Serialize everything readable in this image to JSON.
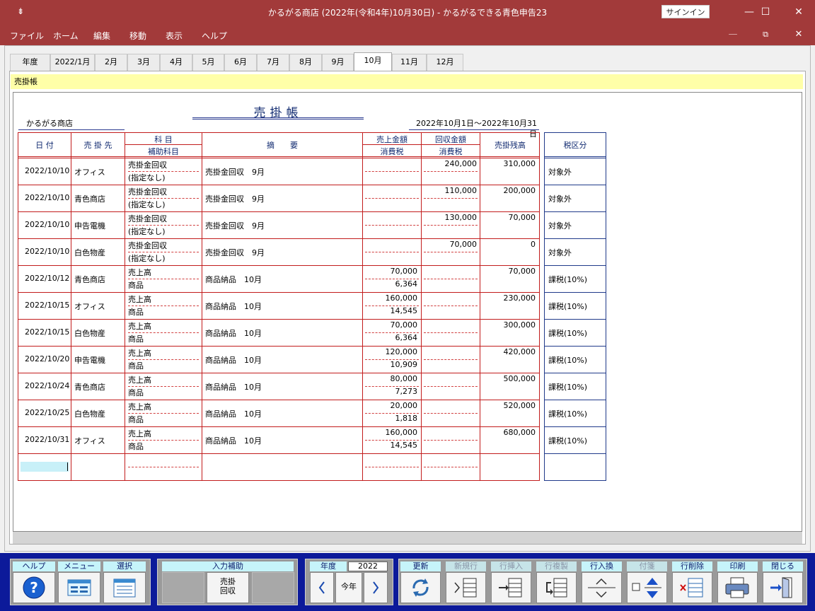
{
  "window": {
    "title": "かるがる商店 (2022年(令和4年)10月30日)  -  かるがるできる青色申告23",
    "signin": "サインイン",
    "sys_menu_glyph": "⇟"
  },
  "menu": [
    "ファイル",
    "ホーム",
    "編集",
    "移動",
    "表示",
    "ヘルプ"
  ],
  "tabs": [
    "年度",
    "2022/1月",
    "2月",
    "3月",
    "4月",
    "5月",
    "6月",
    "7月",
    "8月",
    "9月",
    "10月",
    "11月",
    "12月"
  ],
  "active_tab": "10月",
  "section_label": "売掛帳",
  "ledger": {
    "title": "売掛帳",
    "shop": "かるがる商店",
    "period": "2022年10月1日～2022年10月31日",
    "headers": {
      "date": "日 付",
      "customer": "売 掛 先",
      "account": "科 目",
      "sub_account": "補助科目",
      "summary": "摘　　要",
      "sales": "売上金額",
      "sales_tax": "消費税",
      "collect": "回収金額",
      "collect_tax": "消費税",
      "balance": "売掛残高",
      "tax_class": "税区分"
    },
    "rows": [
      {
        "date": "2022/10/10",
        "customer": "オフィス",
        "account": "売掛金回収",
        "sub": "(指定なし)",
        "summary": "売掛金回収　9月",
        "sales": "",
        "sales_tax": "",
        "collect": "240,000",
        "balance": "310,000",
        "tax_class": "対象外"
      },
      {
        "date": "2022/10/10",
        "customer": "青色商店",
        "account": "売掛金回収",
        "sub": "(指定なし)",
        "summary": "売掛金回収　9月",
        "sales": "",
        "sales_tax": "",
        "collect": "110,000",
        "balance": "200,000",
        "tax_class": "対象外"
      },
      {
        "date": "2022/10/10",
        "customer": "申告電機",
        "account": "売掛金回収",
        "sub": "(指定なし)",
        "summary": "売掛金回収　9月",
        "sales": "",
        "sales_tax": "",
        "collect": "130,000",
        "balance": "70,000",
        "tax_class": "対象外"
      },
      {
        "date": "2022/10/10",
        "customer": "白色物産",
        "account": "売掛金回収",
        "sub": "(指定なし)",
        "summary": "売掛金回収　9月",
        "sales": "",
        "sales_tax": "",
        "collect": "70,000",
        "balance": "0",
        "tax_class": "対象外"
      },
      {
        "date": "2022/10/12",
        "customer": "青色商店",
        "account": "売上高",
        "sub": "商品",
        "summary": "商品納品　10月",
        "sales": "70,000",
        "sales_tax": "6,364",
        "collect": "",
        "balance": "70,000",
        "tax_class": "課税(10%)"
      },
      {
        "date": "2022/10/15",
        "customer": "オフィス",
        "account": "売上高",
        "sub": "商品",
        "summary": "商品納品　10月",
        "sales": "160,000",
        "sales_tax": "14,545",
        "collect": "",
        "balance": "230,000",
        "tax_class": "課税(10%)"
      },
      {
        "date": "2022/10/15",
        "customer": "白色物産",
        "account": "売上高",
        "sub": "商品",
        "summary": "商品納品　10月",
        "sales": "70,000",
        "sales_tax": "6,364",
        "collect": "",
        "balance": "300,000",
        "tax_class": "課税(10%)"
      },
      {
        "date": "2022/10/20",
        "customer": "申告電機",
        "account": "売上高",
        "sub": "商品",
        "summary": "商品納品　10月",
        "sales": "120,000",
        "sales_tax": "10,909",
        "collect": "",
        "balance": "420,000",
        "tax_class": "課税(10%)"
      },
      {
        "date": "2022/10/24",
        "customer": "青色商店",
        "account": "売上高",
        "sub": "商品",
        "summary": "商品納品　10月",
        "sales": "80,000",
        "sales_tax": "7,273",
        "collect": "",
        "balance": "500,000",
        "tax_class": "課税(10%)"
      },
      {
        "date": "2022/10/25",
        "customer": "白色物産",
        "account": "売上高",
        "sub": "商品",
        "summary": "商品納品　10月",
        "sales": "20,000",
        "sales_tax": "1,818",
        "collect": "",
        "balance": "520,000",
        "tax_class": "課税(10%)"
      },
      {
        "date": "2022/10/31",
        "customer": "オフィス",
        "account": "売上高",
        "sub": "商品",
        "summary": "商品納品　10月",
        "sales": "160,000",
        "sales_tax": "14,545",
        "collect": "",
        "balance": "680,000",
        "tax_class": "課税(10%)"
      }
    ]
  },
  "toolbar": {
    "help": "ヘルプ",
    "menu": "メニュー",
    "select": "選択",
    "input_assist": "入力補助",
    "collect_button": "売掛\n回収",
    "year_label": "年度",
    "year_value": "2022",
    "this_year": "今年",
    "update": "更新",
    "new_row": "新規行",
    "insert_row": "行挿入",
    "copy_row": "行複製",
    "swap_rows": "行入換",
    "sticky": "付箋",
    "delete_row": "行削除",
    "print": "印刷",
    "close": "閉じる"
  },
  "colors": {
    "title_bar": "#a23a3a",
    "grid_red": "#c21c1c",
    "toolbar_blue": "#0c1a9a",
    "label_cyan": "#c6f4fa"
  }
}
